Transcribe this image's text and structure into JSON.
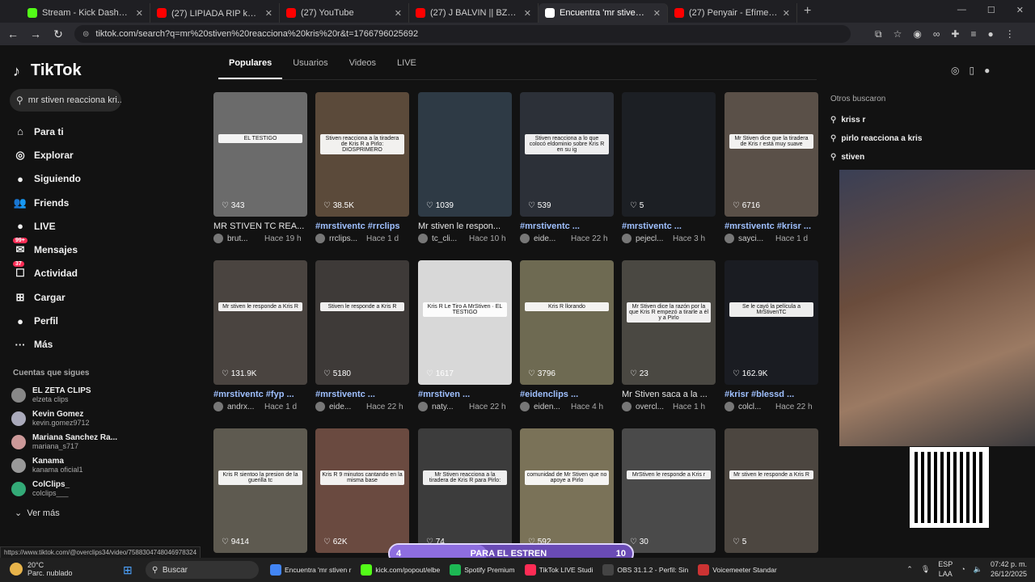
{
  "browser": {
    "tabs": [
      {
        "title": "Stream - Kick Dashboard",
        "color": "#53fc18",
        "active": false
      },
      {
        "title": "(27) LIPIADA RIP kk 🙏🏻 @Ef",
        "color": "#ff0000",
        "active": false
      },
      {
        "title": "(27) YouTube",
        "color": "#ff0000",
        "active": false
      },
      {
        "title": "(27) J BALVIN || BZRP Music Ses",
        "color": "#ff0000",
        "active": false
      },
      {
        "title": "Encuentra 'mr stiven reacciona",
        "color": "#ffffff",
        "active": true
      },
      {
        "title": "(27) Penyair - Efímero ft @Efi",
        "color": "#ff0000",
        "active": false
      }
    ],
    "new_tab": "+",
    "url": "tiktok.com/search?q=mr%20stiven%20reacciona%20kris%20r&t=1766796025692"
  },
  "sidebar": {
    "logo": "TikTok",
    "search_value": "mr stiven reacciona kri...",
    "nav": [
      {
        "label": "Para ti",
        "icon": "home-icon",
        "glyph": "⌂"
      },
      {
        "label": "Explorar",
        "icon": "compass-icon",
        "glyph": "◎"
      },
      {
        "label": "Siguiendo",
        "icon": "following-icon",
        "glyph": "●"
      },
      {
        "label": "Friends",
        "icon": "friends-icon",
        "glyph": "👥"
      },
      {
        "label": "LIVE",
        "icon": "live-icon",
        "glyph": "●"
      },
      {
        "label": "Mensajes",
        "icon": "messages-icon",
        "glyph": "✉",
        "badge": "99+"
      },
      {
        "label": "Actividad",
        "icon": "activity-icon",
        "glyph": "☐",
        "badge": "37"
      },
      {
        "label": "Cargar",
        "icon": "upload-icon",
        "glyph": "⊞"
      },
      {
        "label": "Perfil",
        "icon": "profile-icon",
        "glyph": "●"
      },
      {
        "label": "Más",
        "icon": "more-icon",
        "glyph": "···"
      }
    ],
    "following_title": "Cuentas que sigues",
    "following": [
      {
        "name": "EL ZETA CLIPS",
        "user": "elzeta clips",
        "color": "#888"
      },
      {
        "name": "Kevin Gomez",
        "user": "kevin.gomez9712",
        "color": "#aab"
      },
      {
        "name": "Mariana Sanchez Ra...",
        "user": "mariana_s717",
        "color": "#c99"
      },
      {
        "name": "Kanama",
        "user": "kanama oficial1",
        "color": "#999"
      },
      {
        "name": "ColClips_",
        "user": "colclips___",
        "color": "#3a7"
      }
    ],
    "see_more": "Ver más"
  },
  "filters": [
    "Populares",
    "Usuarios",
    "Videos",
    "LIVE"
  ],
  "videos": [
    {
      "likes": "343",
      "desc": "MR STIVEN TC REA...",
      "author": "brut...",
      "time": "Hace 19 h",
      "tag": false,
      "caption": "EL TESTIGO",
      "bg": "#6b6b6b"
    },
    {
      "likes": "38.5K",
      "desc": "#mrstiventc #rrclips",
      "author": "rrclips...",
      "time": "Hace 1 d",
      "tag": true,
      "caption": "Stiven reacciona a la tiradera de Kris R a Pirlo: DIOSPRIMERO",
      "bg": "#5b4a3a"
    },
    {
      "likes": "1039",
      "desc": "Mr stiven le respon...",
      "author": "tc_cli...",
      "time": "Hace 10 h",
      "tag": false,
      "caption": "",
      "bg": "#2e3a45"
    },
    {
      "likes": "539",
      "desc": "#mrstiventc ...",
      "author": "eide...",
      "time": "Hace 22 h",
      "tag": true,
      "caption": "Stiven reacciona a lo que colocó eldominio sobre Kris R en su ig",
      "bg": "#2c3038"
    },
    {
      "likes": "5",
      "desc": "#mrstiventc ...",
      "author": "pejecl...",
      "time": "Hace 3 h",
      "tag": true,
      "caption": "",
      "bg": "#1c1f24"
    },
    {
      "likes": "6716",
      "desc": "#mrstiventc #krisr ...",
      "author": "sayci...",
      "time": "Hace 1 d",
      "tag": true,
      "caption": "Mr Stiven dice que la tiradera de Kris r está muy suave",
      "bg": "#5a5048"
    },
    {
      "likes": "131.9K",
      "desc": "#mrstiventc #fyp ...",
      "author": "andrx...",
      "time": "Hace 1 d",
      "tag": true,
      "caption": "Mr stiven le responde a Kris R",
      "bg": "#4a4440"
    },
    {
      "likes": "5180",
      "desc": "#mrstiventc ...",
      "author": "eide...",
      "time": "Hace 22 h",
      "tag": true,
      "caption": "Stiven le responde a Kris R",
      "bg": "#3e3a38"
    },
    {
      "likes": "1617",
      "desc": "#mrstiven ...",
      "author": "naty...",
      "time": "Hace 22 h",
      "tag": true,
      "caption": "Kris R Le Tiro A MrStiven · EL TESTIGO",
      "bg": "#d8d8d8"
    },
    {
      "likes": "3796",
      "desc": "#eidenclips ...",
      "author": "eiden...",
      "time": "Hace 4 h",
      "tag": true,
      "caption": "Kris R llorando",
      "bg": "#6e6a52"
    },
    {
      "likes": "23",
      "desc": "Mr Stiven saca a la ...",
      "author": "overcl...",
      "time": "Hace 1 h",
      "tag": false,
      "caption": "Mr Stiven dice la razón por la que Kris R empezó a tirarle a él y a Pirlo",
      "bg": "#4a4842"
    },
    {
      "likes": "162.9K",
      "desc": "#krisr #blessd ...",
      "author": "colcl...",
      "time": "Hace 22 h",
      "tag": true,
      "caption": "Se le cayó la película a MrStivenTC",
      "bg": "#1a1c22"
    },
    {
      "likes": "9414",
      "desc": "",
      "author": "",
      "time": "",
      "tag": false,
      "caption": "Kris R sientoo la presion de la guerilla tc",
      "bg": "#5e5a50"
    },
    {
      "likes": "62K",
      "desc": "",
      "author": "",
      "time": "",
      "tag": false,
      "caption": "Kris R 9 minutos cantando en la misma base",
      "bg": "#6a4a40"
    },
    {
      "likes": "74",
      "desc": "",
      "author": "",
      "time": "",
      "tag": false,
      "caption": "Mr Stiven reacciona a la tiradera de Kris R para Pirlo:",
      "bg": "#3c3c3c"
    },
    {
      "likes": "592",
      "desc": "",
      "author": "",
      "time": "",
      "tag": false,
      "caption": "comunidad de Mr Stiven que no apoye a Pirlo",
      "bg": "#7a7258"
    },
    {
      "likes": "30",
      "desc": "",
      "author": "",
      "time": "",
      "tag": false,
      "caption": "MrStiven le responde a Kris r",
      "bg": "#4a4a4a"
    },
    {
      "likes": "5",
      "desc": "",
      "author": "",
      "time": "",
      "tag": false,
      "caption": "Mr stiven le responde a Kris R",
      "bg": "#4c4640"
    }
  ],
  "others_title": "Otros buscaron",
  "others": [
    "kriss r",
    "pirlo reacciona a kris",
    "stiven"
  ],
  "overlay": {
    "left": "4",
    "label": "PARA EL ESTREN",
    "right": "10",
    "progress": 0.4
  },
  "status_url": "https://www.tiktok.com/@overclips34/video/7588304748046978324",
  "taskbar": {
    "weather_temp": "20°C",
    "weather_desc": "Parc. nublado",
    "search": "Buscar",
    "apps": [
      {
        "label": "Encuentra 'mr stiven r",
        "color": "#4285f4"
      },
      {
        "label": "kick.com/popout/elbe",
        "color": "#53fc18"
      },
      {
        "label": "Spotify Premium",
        "color": "#1db954"
      },
      {
        "label": "TikTok LIVE Studi",
        "color": "#fe2c55"
      },
      {
        "label": "OBS 31.1.2 - Perfil: Sin",
        "color": "#444"
      },
      {
        "label": "Voicemeeter Standar",
        "color": "#c33"
      }
    ],
    "lang": "ESP",
    "lang2": "LAA",
    "time": "07:42 p. m.",
    "date": "26/12/2025"
  }
}
